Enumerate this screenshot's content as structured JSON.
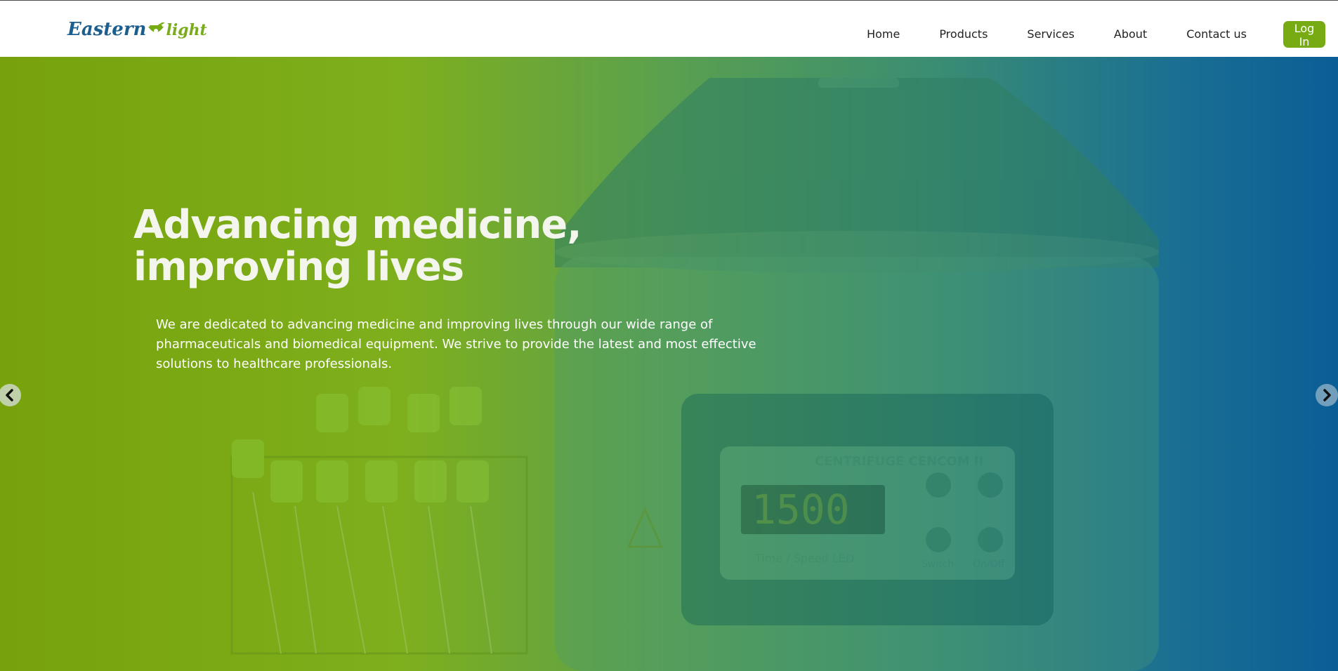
{
  "brand": {
    "logo_part1": "Eastern",
    "logo_part2": "light"
  },
  "nav": {
    "items": [
      "Home",
      "Products",
      "Services",
      "About",
      "Contact us"
    ],
    "login_label": "Log In"
  },
  "hero": {
    "title_line1": "Advancing medicine,",
    "title_line2": "improving lives",
    "description": "We are dedicated to advancing medicine and improving lives through our wide range of pharmaceuticals and biomedical equipment. We strive to provide the latest and most effective solutions to healthcare professionals.",
    "device_label": "CENTRIFUGE  CENCOM II",
    "device_display": "1500",
    "device_caption": "Time / Speed  LED",
    "device_switch": "Switch",
    "device_onoff": "On/Off"
  },
  "carousel": {
    "prev_icon": "chevron-left-icon",
    "next_icon": "chevron-right-icon"
  },
  "colors": {
    "brand_blue": "#1c5f8e",
    "brand_green": "#77ab14",
    "gradient_left": "#77a20b",
    "gradient_right": "#0a5e96"
  }
}
